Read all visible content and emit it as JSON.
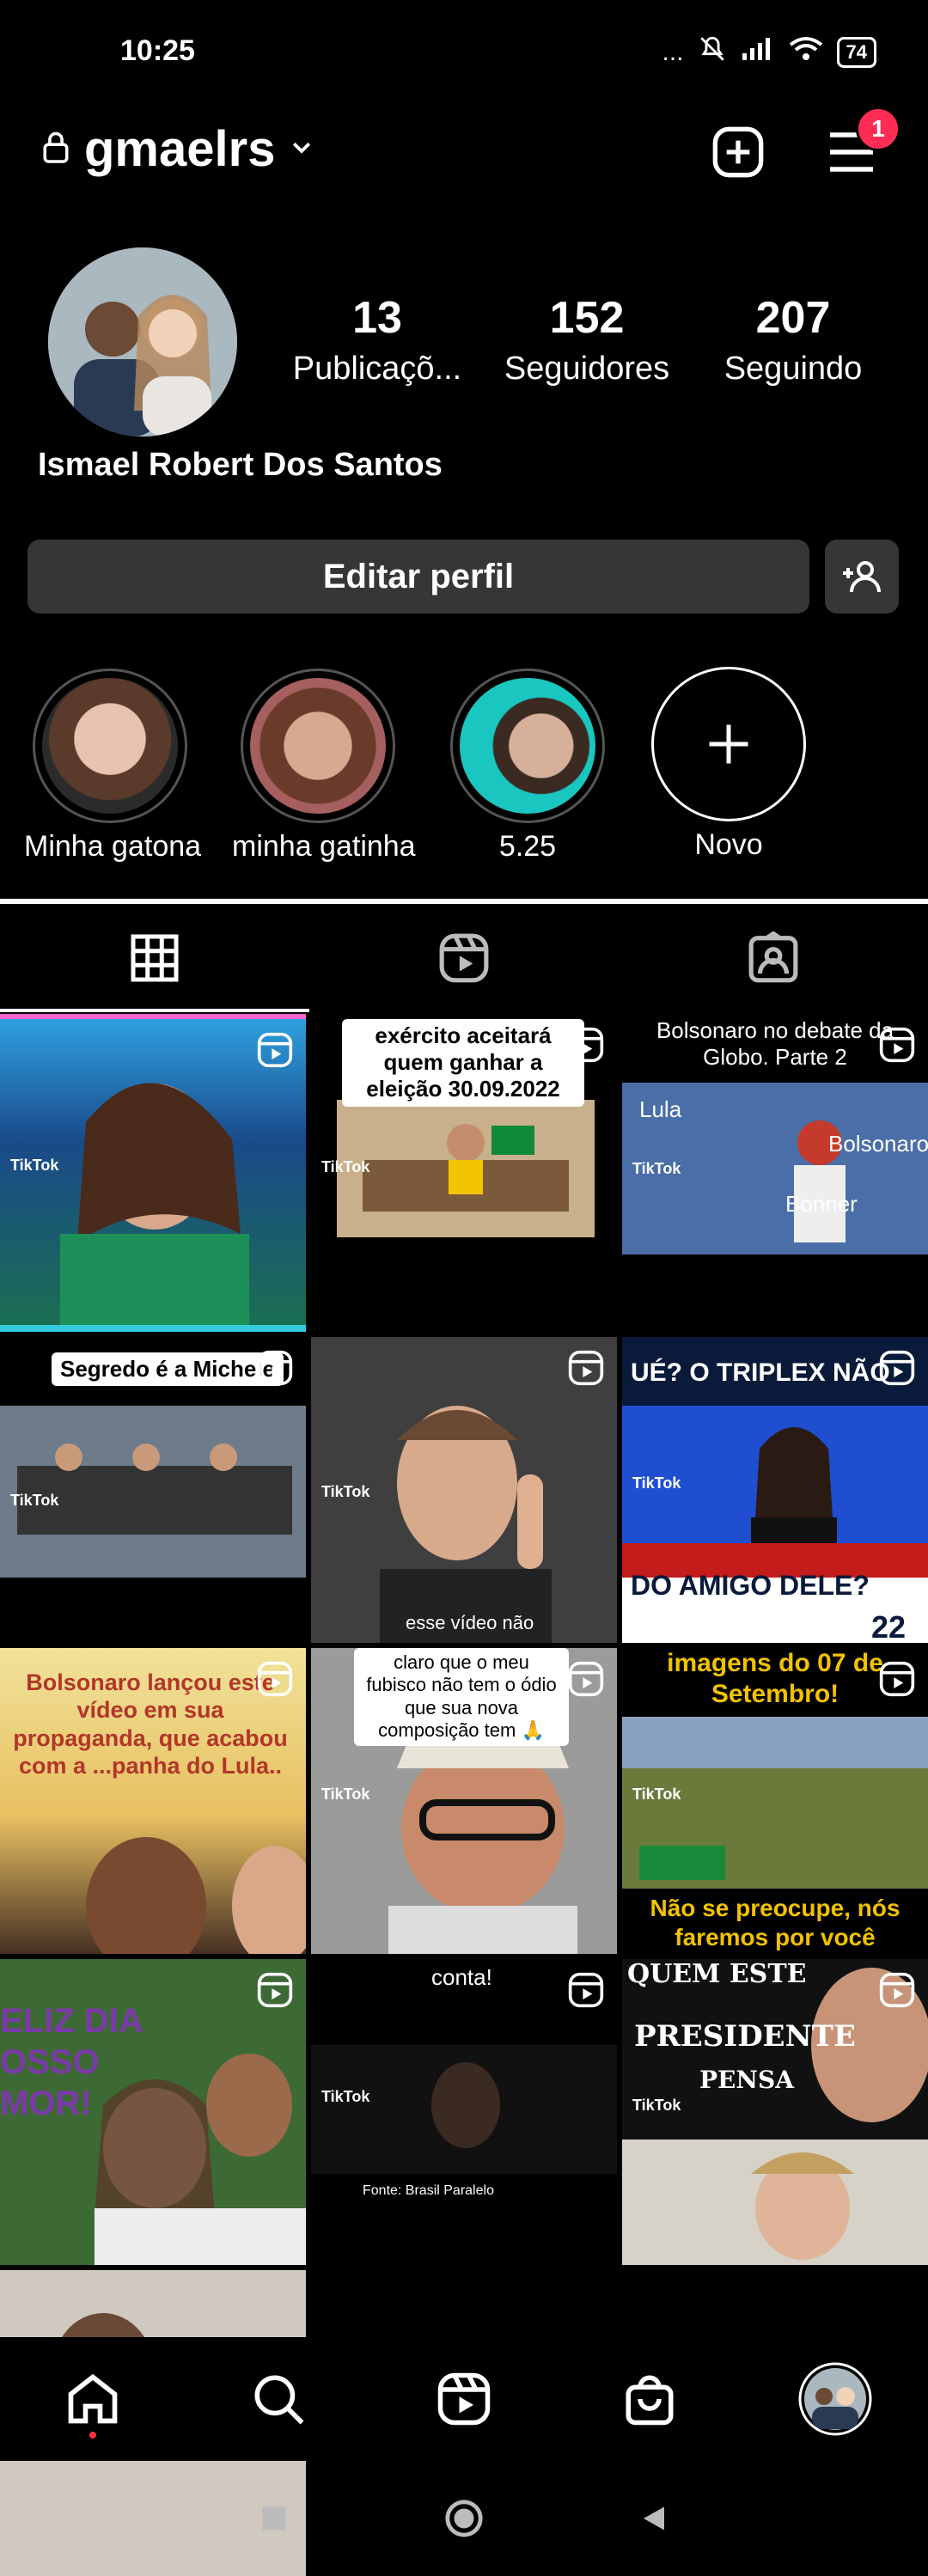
{
  "status_bar": {
    "time": "10:25",
    "dots": "...",
    "battery": "74"
  },
  "header": {
    "username": "gmaelrs",
    "notifications_count": "1"
  },
  "profile": {
    "stats": [
      {
        "value": "13",
        "label": "Publicaçõ..."
      },
      {
        "value": "152",
        "label": "Seguidores"
      },
      {
        "value": "207",
        "label": "Seguindo"
      }
    ],
    "full_name": "Ismael Robert Dos Santos",
    "edit_button": "Editar perfil"
  },
  "highlights": [
    {
      "label": "Minha gatona"
    },
    {
      "label": "minha gatinha"
    },
    {
      "label": "5.25"
    },
    {
      "label": "Novo"
    }
  ],
  "grid": {
    "captions": {
      "c2": "exército aceitará quem ganhar a eleição 30.09.2022",
      "c3_title": "Bolsonaro no debate da Globo. Parte 2",
      "c3_a": "Lula",
      "c3_b": "Bolsonaro",
      "c3_c": "Bonner",
      "c4": "Segredo é a Michele",
      "c5": "esse vídeo não",
      "c6_top": "UÉ? O TRIPLEX NÃO",
      "c6_bottom": "DO AMIGO DELE?",
      "c6_num": "22",
      "c7": "Bolsonaro lançou este vídeo em sua propaganda, que acabou com a ...panha do Lula..",
      "c8": "claro que o meu fubisco não tem o ódio que sua nova composição tem 🙏",
      "c9_top": "imagens do 07 de Setembro!",
      "c9_bottom": "Não se preocupe, nós faremos por você",
      "c10": "ELIZ DIA OSSO MOR!",
      "c11_top": "conta!",
      "c11_bottom": "Fonte: Brasil Paralelo",
      "c12_a": "QUEM ESTE",
      "c12_b": "PRESIDENTE",
      "c12_c": "PENSA",
      "tiktok": "TikTok"
    }
  }
}
